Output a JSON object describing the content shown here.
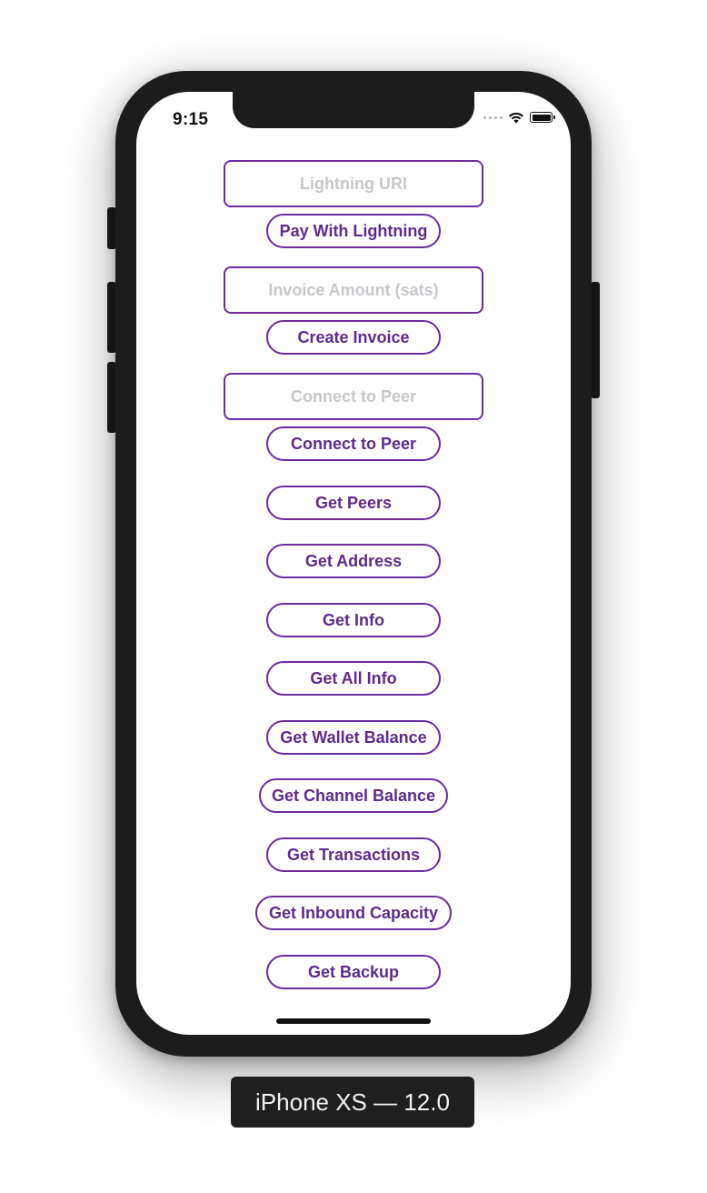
{
  "status_bar": {
    "time": "9:15",
    "icons": [
      "signal-dots-icon",
      "wifi-icon",
      "battery-icon"
    ]
  },
  "fields": {
    "lightning_uri": {
      "placeholder": "Lightning URI",
      "value": ""
    },
    "invoice_amount": {
      "placeholder": "Invoice Amount (sats)",
      "value": ""
    },
    "connect_peer": {
      "placeholder": "Connect to Peer",
      "value": ""
    }
  },
  "buttons": {
    "pay_with_lightning": "Pay With Lightning",
    "create_invoice": "Create Invoice",
    "connect_to_peer": "Connect to Peer",
    "get_peers": "Get Peers",
    "get_address": "Get Address",
    "get_info": "Get Info",
    "get_all_info": "Get All Info",
    "get_wallet_balance": "Get Wallet Balance",
    "get_channel_balance": "Get Channel Balance",
    "get_transactions": "Get Transactions",
    "get_inbound_capacity": "Get Inbound Capacity",
    "get_backup": "Get Backup"
  },
  "device_label": "iPhone XS — 12.0",
  "colors": {
    "accent": "#6a2c9e",
    "button_text": "#5e2a8c",
    "placeholder": "#c8c8cc",
    "device_frame": "#1c1c1c"
  }
}
